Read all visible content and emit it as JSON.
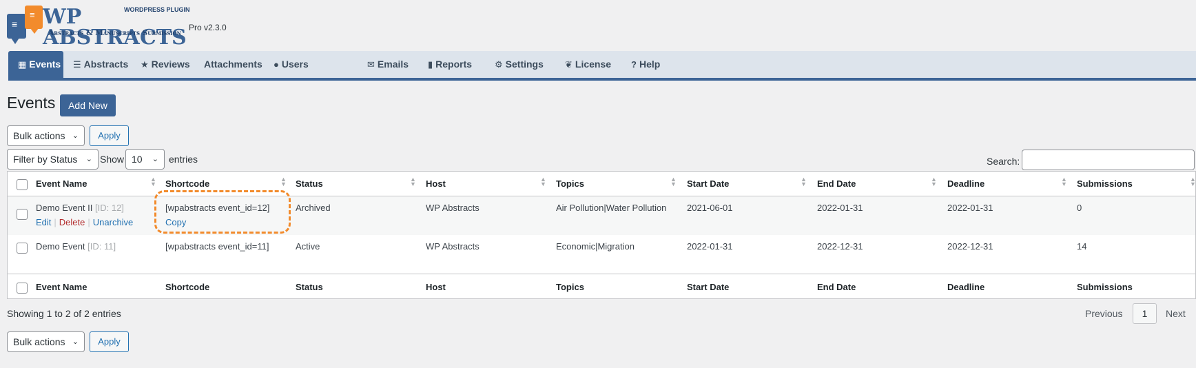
{
  "header": {
    "brand": "WP ABSTRACTS",
    "plugin_label": "WORDPRESS PLUGIN",
    "subtitle": "Abstracts & Manuscripts Submission",
    "version": "Pro v2.3.0"
  },
  "nav": {
    "tabs": [
      {
        "label": "Events",
        "icon": "calendar-icon",
        "active": true
      },
      {
        "label": "Abstracts",
        "icon": "list-icon"
      },
      {
        "label": "Reviews",
        "icon": "star-icon"
      },
      {
        "label": "Attachments",
        "icon": ""
      },
      {
        "label": "Users",
        "icon": "user-icon"
      },
      {
        "label": "Emails",
        "icon": "envelope-icon"
      },
      {
        "label": "Reports",
        "icon": "bar-chart-icon"
      },
      {
        "label": "Settings",
        "icon": "gear-icon"
      },
      {
        "label": "License",
        "icon": "leaf-icon"
      },
      {
        "label": "Help",
        "icon": "help-icon"
      }
    ]
  },
  "page": {
    "title": "Events",
    "add_new_label": "Add New"
  },
  "controls": {
    "bulk_actions": "Bulk actions",
    "apply": "Apply",
    "filter_status": "Filter by Status",
    "show_label": "Show",
    "entries_value": "10",
    "entries_label": "entries",
    "search_label": "Search:",
    "search_value": ""
  },
  "table": {
    "columns": [
      "Event Name",
      "Shortcode",
      "Status",
      "Host",
      "Topics",
      "Start Date",
      "End Date",
      "Deadline",
      "Submissions"
    ],
    "rows": [
      {
        "name": "Demo Event II",
        "id": "[ID: 12]",
        "shortcode": "[wpabstracts event_id=12]",
        "status": "Archived",
        "host": "WP Abstracts",
        "topics": "Air Pollution|Water Pollution",
        "start": "2021-06-01",
        "end": "2022-01-31",
        "deadline": "2022-01-31",
        "submissions": "0",
        "actions": {
          "edit": "Edit",
          "delete": "Delete",
          "unarchive": "Unarchive",
          "copy": "Copy"
        }
      },
      {
        "name": "Demo Event",
        "id": "[ID: 11]",
        "shortcode": "[wpabstracts event_id=11]",
        "status": "Active",
        "host": "WP Abstracts",
        "topics": "Economic|Migration",
        "start": "2022-01-31",
        "end": "2022-12-31",
        "deadline": "2022-12-31",
        "submissions": "14"
      }
    ]
  },
  "footer": {
    "showing": "Showing 1 to 2 of 2 entries",
    "previous": "Previous",
    "page": "1",
    "next": "Next"
  },
  "colors": {
    "accent": "#3c6496",
    "highlight_dash": "#f28b2c",
    "link": "#2271b1",
    "delete": "#b32d2e"
  }
}
